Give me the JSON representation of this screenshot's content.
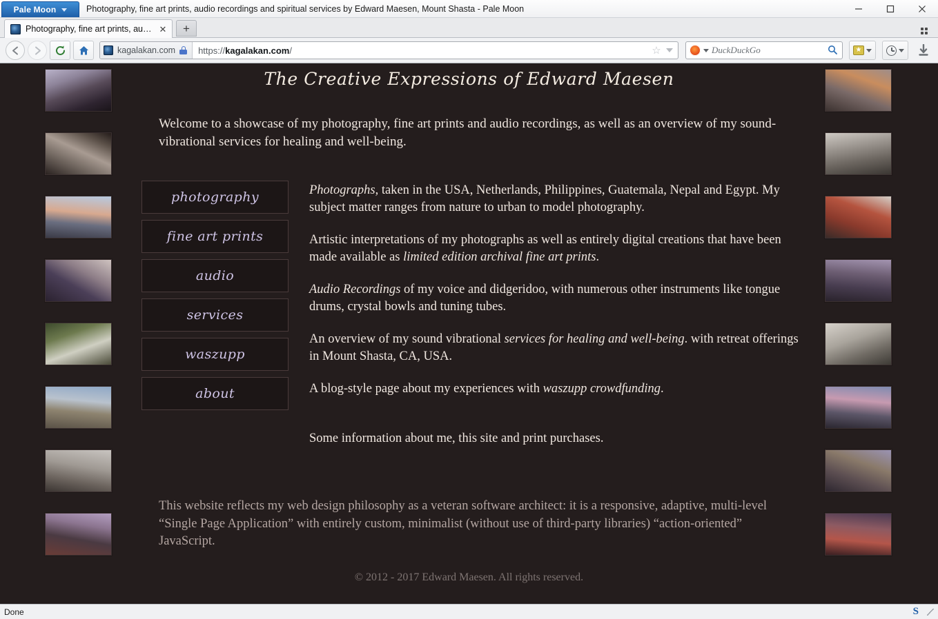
{
  "browser": {
    "app_menu_label": "Pale Moon",
    "window_title": "Photography, fine art prints, audio recordings and spiritual services by Edward Maesen, Mount Shasta - Pale Moon",
    "window_controls": {
      "minimize": "—",
      "maximize": "☐",
      "close": "✕"
    },
    "tab": {
      "label": "Photography, fine art prints, audio re...",
      "close": "✕"
    },
    "new_tab_label": "+",
    "nav": {
      "back": "←",
      "forward": "→",
      "reload": "⟳",
      "home": "⌂"
    },
    "identity_label": "kagalakan.com",
    "url_prefix": "https://",
    "url_domain": "kagalakan.com",
    "url_suffix": "/",
    "bookmark_star": "☆",
    "search": {
      "engine": "DuckDuckGo",
      "placeholder": "DuckDuckGo",
      "magnifier": "⌕"
    },
    "download_arrow": "⬇",
    "status_text": "Done",
    "sync_label": "S"
  },
  "site": {
    "title": "The Creative Expressions of Edward Maesen",
    "intro": "Welcome to a showcase of my photography, fine art prints and audio recordings, as well as an overview of my sound-vibrational services for healing and well-being.",
    "nav_buttons": [
      {
        "label": "photography"
      },
      {
        "label": "fine art prints"
      },
      {
        "label": "audio"
      },
      {
        "label": "services"
      },
      {
        "label": "waszupp"
      },
      {
        "label": "about"
      }
    ],
    "descriptions": [
      {
        "lead": "Photographs",
        "rest": ", taken in the USA, Netherlands, Philippines, Guatemala, Nepal and Egypt. My subject matter ranges from nature to urban to model photography."
      },
      {
        "pre": "Artistic interpretations of my photographs as well as entirely digital creations that have been made available as ",
        "em": "limited edition archival fine art prints",
        "post": "."
      },
      {
        "lead": "Audio Recordings",
        "rest": " of my voice and didgeridoo, with numerous other instruments like tongue drums, crystal bowls and tuning tubes."
      },
      {
        "pre": "An overview of my sound vibrational ",
        "em": "services for healing and well-being",
        "post": ". with retreat offerings in Mount Shasta, CA, USA."
      },
      {
        "pre": "A blog-style page about my experiences with ",
        "em": "waszupp crowdfunding",
        "post": "."
      },
      {
        "plain": "Some information about me, this site and print purchases."
      }
    ],
    "philosophy": "This website reflects my web design philosophy as a veteran software architect: it is a responsive, adaptive, multi-level “Single Page Application” with entirely custom, minimalist (without use of third-party libraries) “action-oriented” JavaScript.",
    "copyright": "© 2012 - 2017 Edward Maesen. All rights reserved.",
    "background_color": "#241d1d",
    "accent_color": "#cfc4e6",
    "thumbnails_left": [
      {
        "name": "windmill-thumbnail",
        "css": "linear-gradient(160deg,#b9b2c9 0%,#8d8399 28%,#574a58 52%,#2e2430 78%,#1a1419 100%)"
      },
      {
        "name": "abandoned-cars-forest-thumbnail",
        "css": "linear-gradient(25deg,#2a2220 0%,#6f655e 30%,#a89b92 55%,#5c5149 80%,#241c1a 100%)"
      },
      {
        "name": "harbor-crane-sunset-thumbnail",
        "css": "linear-gradient(185deg,#b6c9e0 0%,#d8a98f 40%,#6a6e80 65%,#3a3a46 100%)"
      },
      {
        "name": "woman-sitting-rocks-thumbnail",
        "css": "linear-gradient(210deg,#cfc3c0 0%,#8d7d87 35%,#4b3f58 60%,#2b2230 100%)"
      },
      {
        "name": "geese-garden-thumbnail",
        "css": "linear-gradient(160deg,#3d4a2c 0%,#6d7a4e 30%,#cfcfc2 60%,#4a4a38 100%)"
      },
      {
        "name": "mountain-valley-thumbnail",
        "css": "linear-gradient(185deg,#8fa8c6 0%,#b9c2cd 35%,#8e8470 60%,#5a5247 100%)"
      },
      {
        "name": "street-town-cars-thumbnail",
        "css": "linear-gradient(190deg,#c8c4c0 0%,#a09a94 40%,#6d655f 70%,#3b3532 100%)"
      },
      {
        "name": "trees-dusk-thumbnail",
        "css": "linear-gradient(190deg,#b39ec0 0%,#8c7590 30%,#4a3a42 60%,#6a3c37 100%)"
      }
    ],
    "thumbnails_right": [
      {
        "name": "street-performer-thumbnail",
        "css": "linear-gradient(200deg,#9e8d8a 0%,#c98d5e 30%,#7a6a68 60%,#3c3230 100%)"
      },
      {
        "name": "deer-portrait-thumbnail",
        "css": "linear-gradient(170deg,#cfcac4 0%,#9a948e 35%,#6c6660 65%,#3a3632 100%)"
      },
      {
        "name": "cable-car-thumbnail",
        "css": "linear-gradient(200deg,#d3cfc8 0%,#b5543f 35%,#8a3a2c 65%,#3a2b28 100%)"
      },
      {
        "name": "boy-at-window-thumbnail",
        "css": "linear-gradient(185deg,#a394b0 0%,#6e5f74 35%,#483d50 65%,#2a232c 100%)"
      },
      {
        "name": "woman-brick-wall-thumbnail",
        "css": "linear-gradient(160deg,#d7d2cb 0%,#a9a49c 40%,#6f6a63 70%,#3d3a35 100%)"
      },
      {
        "name": "mount-shasta-sunset-thumbnail",
        "css": "linear-gradient(185deg,#7f8bb0 0%,#c79ab0 35%,#5c5668 65%,#2b2730 100%)"
      },
      {
        "name": "canal-boat-autumn-thumbnail",
        "css": "linear-gradient(200deg,#9a93b3 0%,#8a7a6a 35%,#5d4f52 65%,#2e2730 100%)"
      },
      {
        "name": "dancers-at-dusk-thumbnail",
        "css": "linear-gradient(185deg,#4a3a52 0%,#8d5a62 35%,#b4564a 65%,#3a1f22 100%)"
      }
    ]
  }
}
